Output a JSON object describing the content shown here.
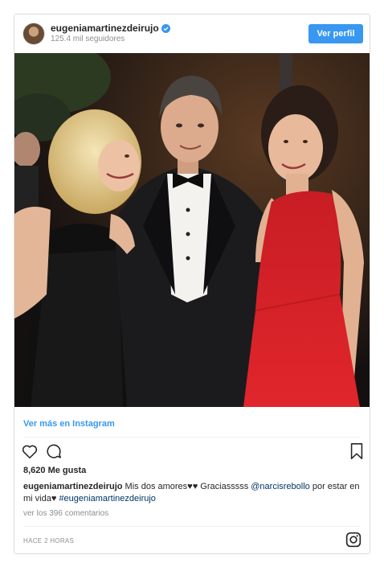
{
  "header": {
    "username": "eugeniamartinezdeirujo",
    "followers": "125.4 mil seguidores",
    "follow_label": "Ver perfil",
    "verified_icon": "verified-badge-icon",
    "avatar_icon": "profile-avatar"
  },
  "photo": {
    "description_icon": "post-photo"
  },
  "view_more_label": "Ver más en Instagram",
  "actions": {
    "like_icon": "heart-icon",
    "comment_icon": "comment-icon",
    "save_icon": "bookmark-icon"
  },
  "likes": "8,620 Me gusta",
  "caption": {
    "username": "eugeniamartinezdeirujo",
    "text1": " Mis dos amores♥♥ Graciasssss ",
    "mention": "@narcisrebollo",
    "text2": " por estar en mi vida♥ ",
    "hashtag": "#eugeniamartinezdeirujo"
  },
  "comments_link": "ver los 396 comentarios",
  "timestamp": "HACE 2 HORAS",
  "footer_icon": "instagram-logo-icon",
  "colors": {
    "accent": "#3897f0",
    "link": "#003569",
    "muted": "#8e8e8e",
    "text": "#262626"
  }
}
